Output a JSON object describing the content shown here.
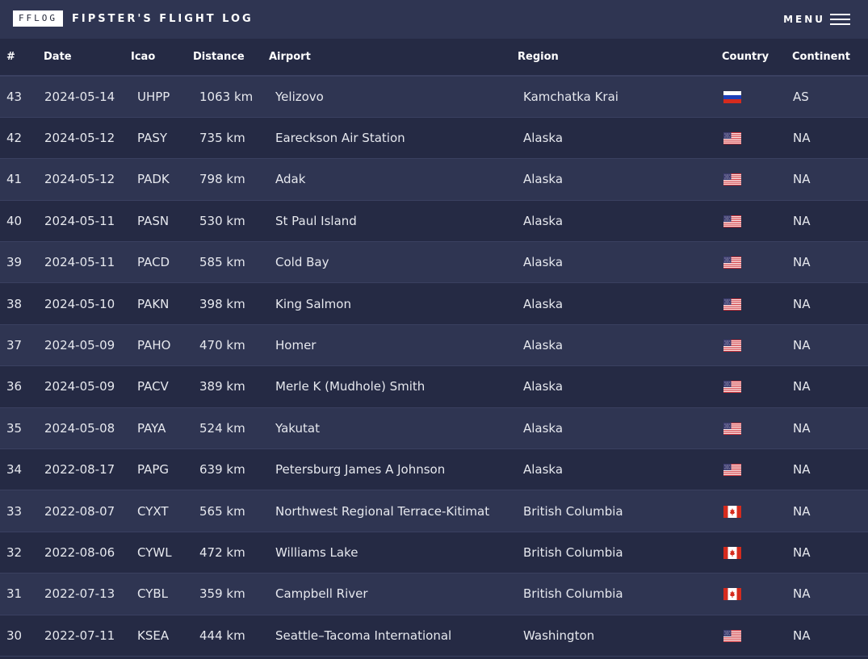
{
  "brand": {
    "logo": "FFLOG",
    "title": "FIPSTER'S FLIGHT LOG"
  },
  "menu": {
    "label": "MENU",
    "icon": "hamburger-icon"
  },
  "table": {
    "columns": [
      "#",
      "Date",
      "Icao",
      "Distance",
      "Airport",
      "Region",
      "Country",
      "Continent"
    ],
    "rows": [
      {
        "num": "43",
        "date": "2024-05-14",
        "icao": "UHPP",
        "distance": "1063 km",
        "airport": "Yelizovo",
        "region": "Kamchatka Krai",
        "country": "russia-flag-icon",
        "continent": "AS"
      },
      {
        "num": "42",
        "date": "2024-05-12",
        "icao": "PASY",
        "distance": "735 km",
        "airport": "Eareckson Air Station",
        "region": "Alaska",
        "country": "usa-flag-icon",
        "continent": "NA"
      },
      {
        "num": "41",
        "date": "2024-05-12",
        "icao": "PADK",
        "distance": "798 km",
        "airport": "Adak",
        "region": "Alaska",
        "country": "usa-flag-icon",
        "continent": "NA"
      },
      {
        "num": "40",
        "date": "2024-05-11",
        "icao": "PASN",
        "distance": "530 km",
        "airport": "St Paul Island",
        "region": "Alaska",
        "country": "usa-flag-icon",
        "continent": "NA"
      },
      {
        "num": "39",
        "date": "2024-05-11",
        "icao": "PACD",
        "distance": "585 km",
        "airport": "Cold Bay",
        "region": "Alaska",
        "country": "usa-flag-icon",
        "continent": "NA"
      },
      {
        "num": "38",
        "date": "2024-05-10",
        "icao": "PAKN",
        "distance": "398 km",
        "airport": "King Salmon",
        "region": "Alaska",
        "country": "usa-flag-icon",
        "continent": "NA"
      },
      {
        "num": "37",
        "date": "2024-05-09",
        "icao": "PAHO",
        "distance": "470 km",
        "airport": "Homer",
        "region": "Alaska",
        "country": "usa-flag-icon",
        "continent": "NA"
      },
      {
        "num": "36",
        "date": "2024-05-09",
        "icao": "PACV",
        "distance": "389 km",
        "airport": "Merle K (Mudhole) Smith",
        "region": "Alaska",
        "country": "usa-flag-icon",
        "continent": "NA"
      },
      {
        "num": "35",
        "date": "2024-05-08",
        "icao": "PAYA",
        "distance": "524 km",
        "airport": "Yakutat",
        "region": "Alaska",
        "country": "usa-flag-icon",
        "continent": "NA"
      },
      {
        "num": "34",
        "date": "2022-08-17",
        "icao": "PAPG",
        "distance": "639 km",
        "airport": "Petersburg James A Johnson",
        "region": "Alaska",
        "country": "usa-flag-icon",
        "continent": "NA"
      },
      {
        "num": "33",
        "date": "2022-08-07",
        "icao": "CYXT",
        "distance": "565 km",
        "airport": "Northwest Regional Terrace-Kitimat",
        "region": "British Columbia",
        "country": "canada-flag-icon",
        "continent": "NA"
      },
      {
        "num": "32",
        "date": "2022-08-06",
        "icao": "CYWL",
        "distance": "472 km",
        "airport": "Williams Lake",
        "region": "British Columbia",
        "country": "canada-flag-icon",
        "continent": "NA"
      },
      {
        "num": "31",
        "date": "2022-07-13",
        "icao": "CYBL",
        "distance": "359 km",
        "airport": "Campbell River",
        "region": "British Columbia",
        "country": "canada-flag-icon",
        "continent": "NA"
      },
      {
        "num": "30",
        "date": "2022-07-11",
        "icao": "KSEA",
        "distance": "444 km",
        "airport": "Seattle–Tacoma International",
        "region": "Washington",
        "country": "usa-flag-icon",
        "continent": "NA"
      }
    ]
  }
}
